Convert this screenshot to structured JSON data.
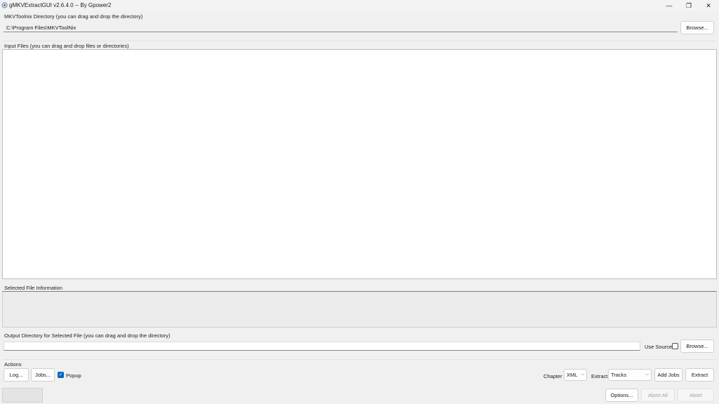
{
  "window": {
    "title": "gMKVExtractGUI v2.6.4.0 -- By Gpower2",
    "minimize_glyph": "—",
    "maximize_glyph": "❐",
    "close_glyph": "✕"
  },
  "mkvtoolnix": {
    "label": "MKVToolnix Directory (you can drag and drop the directory)",
    "path": "C:\\Program Files\\MKVToolNix",
    "browse_label": "Browse..."
  },
  "input_files": {
    "label": "Input Files (you can drag and drop files or directories)"
  },
  "selected_info": {
    "label": "Selected File Information"
  },
  "output": {
    "label": "Output Directory for Selected File (you can drag and drop the directory)",
    "path": "",
    "use_source_label": "Use Source",
    "browse_label": "Browse..."
  },
  "actions": {
    "label": "Actions",
    "log_label": "Log...",
    "jobs_label": "Jobs...",
    "popup_label": "Popup",
    "chapter_label": "Chapter",
    "chapter_value": "XML",
    "extract_label": "Extract",
    "extract_value": "Tracks",
    "add_jobs_label": "Add Jobs",
    "extract_button_label": "Extract"
  },
  "bottom": {
    "options_label": "Options...",
    "abort_all_label": "Abort All",
    "abort_label": "Abort"
  },
  "colors": {
    "accent": "#0067c0",
    "background": "#f0f0f0"
  }
}
